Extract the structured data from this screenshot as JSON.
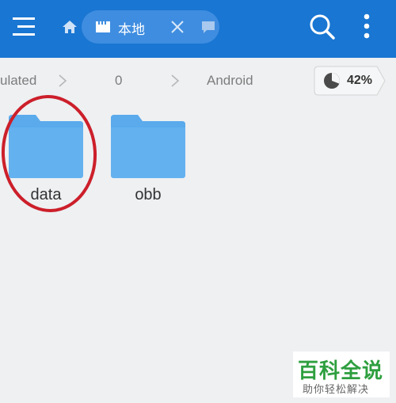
{
  "toolbar": {
    "tab_label": "本地",
    "icons": [
      "menu-icon",
      "home-icon",
      "sd-card-icon",
      "close-icon",
      "window-icon",
      "search-icon",
      "more-vertical-icon"
    ]
  },
  "breadcrumb": {
    "items": [
      "ulated",
      "0",
      "Android"
    ],
    "storage_usage": "42%"
  },
  "folders": [
    {
      "name": "data"
    },
    {
      "name": "obb"
    }
  ],
  "watermark": {
    "title": "百科全说",
    "subtitle": "助你轻松解决"
  },
  "colors": {
    "toolbar": "#1976d2",
    "folder": "#5aaaec",
    "highlight": "#cc1f2a",
    "watermark_green": "#2e9f3f"
  }
}
